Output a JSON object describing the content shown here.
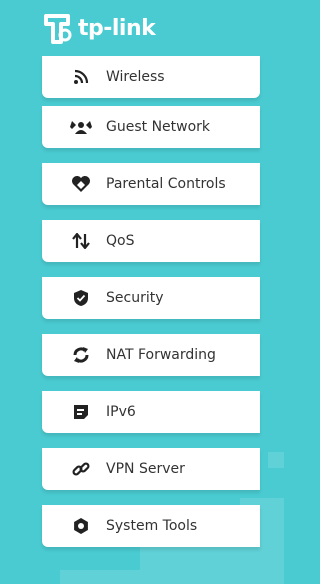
{
  "brand": {
    "name": "tp-link",
    "logo_icon": "tp-link-logo",
    "background_color": "#4acbd1",
    "text_color": "#333333"
  },
  "sidebar": {
    "items": [
      {
        "label": "Wireless",
        "icon": "wifi-icon"
      },
      {
        "label": "Guest Network",
        "icon": "guest-network-icon"
      },
      {
        "label": "Parental Controls",
        "icon": "heart-icon"
      },
      {
        "label": "QoS",
        "icon": "qos-arrows-icon"
      },
      {
        "label": "Security",
        "icon": "shield-icon"
      },
      {
        "label": "NAT Forwarding",
        "icon": "refresh-icon"
      },
      {
        "label": "IPv6",
        "icon": "ipv6-icon"
      },
      {
        "label": "VPN Server",
        "icon": "link-icon"
      },
      {
        "label": "System Tools",
        "icon": "gear-icon"
      }
    ]
  }
}
